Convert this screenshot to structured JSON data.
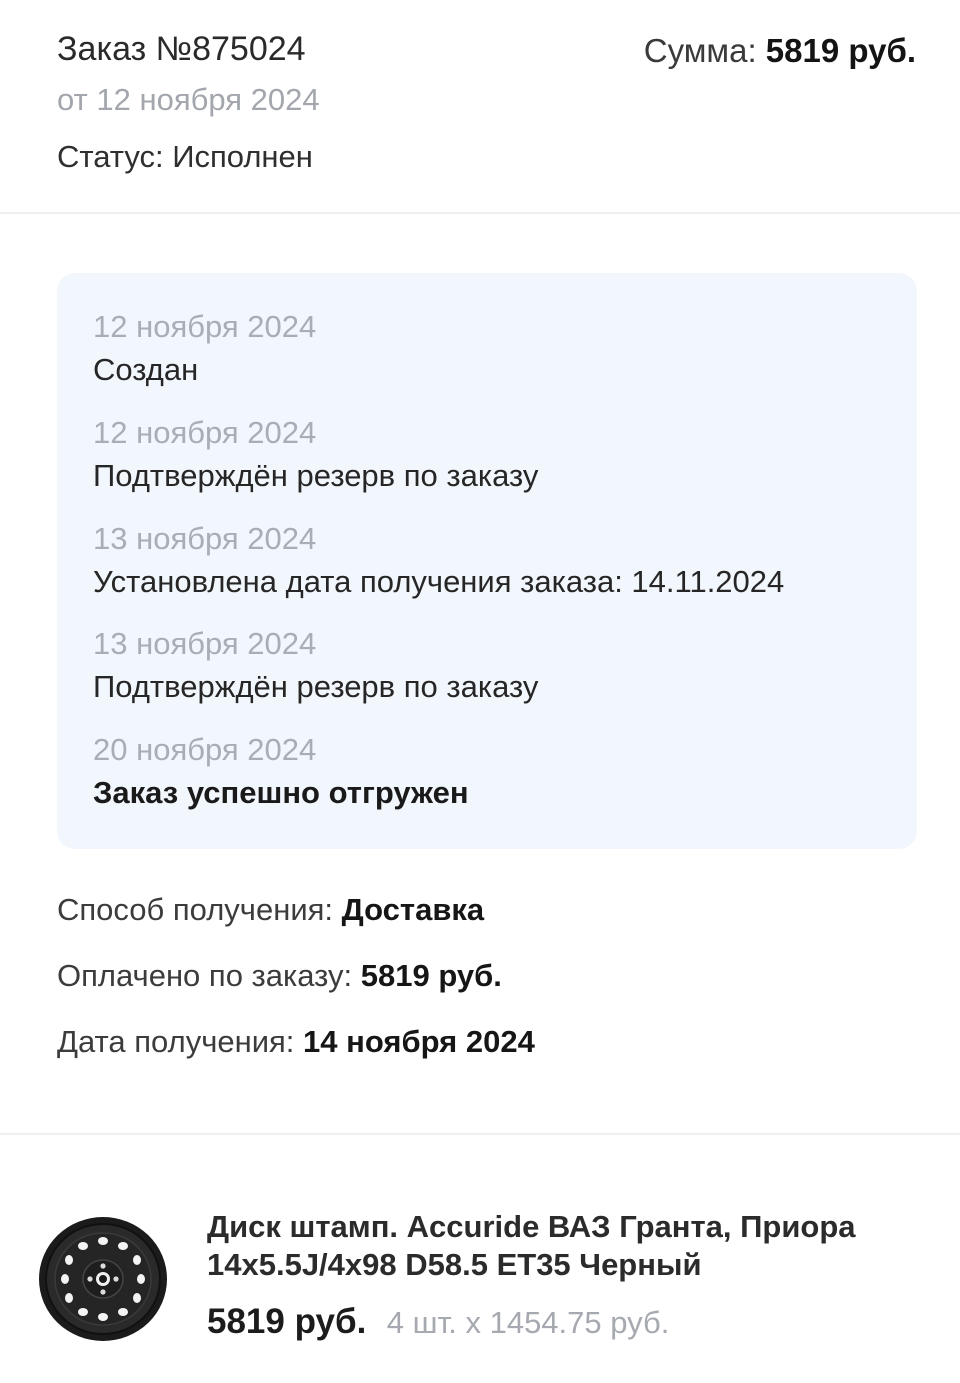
{
  "order": {
    "title": "Заказ №875024",
    "date": "от 12 ноября 2024",
    "status": "Статус: Исполнен",
    "sum_label": "Сумма:",
    "sum_value": "5819 руб."
  },
  "history": [
    {
      "date": "12 ноября 2024",
      "text": "Создан"
    },
    {
      "date": "12 ноября 2024",
      "text": "Подтверждён резерв по заказу"
    },
    {
      "date": "13 ноября 2024",
      "text": "Установлена дата получения заказа: 14.11.2024"
    },
    {
      "date": "13 ноября 2024",
      "text": "Подтверждён резерв по заказу"
    },
    {
      "date": "20 ноября 2024",
      "text": "Заказ успешно отгружен"
    }
  ],
  "info": {
    "delivery_label": "Способ получения:",
    "delivery_value": "Доставка",
    "paid_label": "Оплачено по заказу:",
    "paid_value": "5819 руб.",
    "receive_label": "Дата получения:",
    "receive_value": "14 ноября 2024"
  },
  "product": {
    "name_line1": "Диск штамп. Accuride ВАЗ Гранта, Приора",
    "name_line2": "14x5.5J/4x98 D58.5 ET35 Черный",
    "price": "5819 руб.",
    "quantity": "4 шт. x 1454.75 руб.",
    "icon": "wheel-rim-icon"
  }
}
